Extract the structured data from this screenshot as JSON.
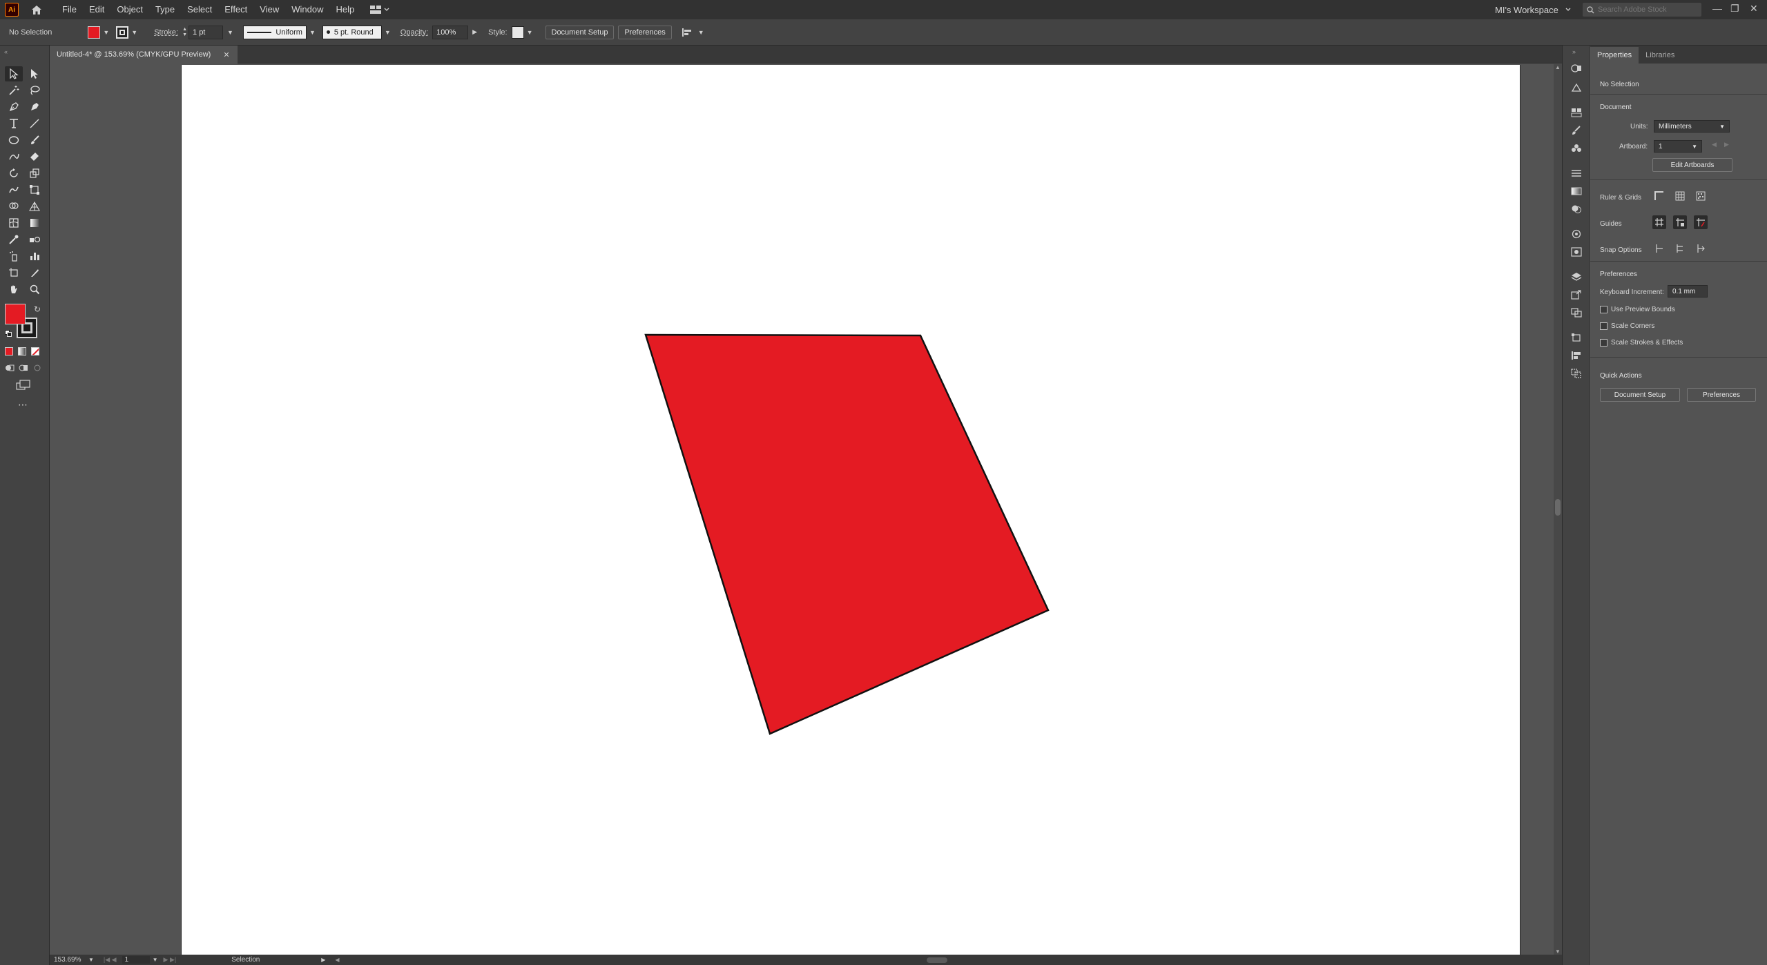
{
  "menubar": {
    "app_logo": "Ai",
    "items": [
      "File",
      "Edit",
      "Object",
      "Type",
      "Select",
      "Effect",
      "View",
      "Window",
      "Help"
    ],
    "workspace": "MI's Workspace",
    "search_placeholder": "Search Adobe Stock"
  },
  "control_bar": {
    "selection_status": "No Selection",
    "fill_color": "#e41b23",
    "stroke_label": "Stroke:",
    "stroke_weight": "1 pt",
    "stroke_profile": "Uniform",
    "brush": "5 pt. Round",
    "opacity_label": "Opacity:",
    "opacity": "100%",
    "style_label": "Style:",
    "document_setup": "Document Setup",
    "preferences": "Preferences"
  },
  "document_tab": {
    "title": "Untitled-4* @ 153.69% (CMYK/GPU Preview)"
  },
  "canvas": {
    "shape_fill": "#e41b23",
    "shape_stroke": "#111111"
  },
  "status_bar": {
    "zoom": "153.69%",
    "artboard_number": "1",
    "tool_status": "Selection"
  },
  "properties": {
    "tabs": [
      "Properties",
      "Libraries"
    ],
    "selection": "No Selection",
    "document_heading": "Document",
    "units_label": "Units:",
    "units_value": "Millimeters",
    "artboard_label": "Artboard:",
    "artboard_value": "1",
    "edit_artboards": "Edit Artboards",
    "ruler_grids": "Ruler & Grids",
    "guides": "Guides",
    "snap_options": "Snap Options",
    "preferences_heading": "Preferences",
    "keyboard_increment_label": "Keyboard Increment:",
    "keyboard_increment_value": "0.1 mm",
    "use_preview_bounds": "Use Preview Bounds",
    "scale_corners": "Scale Corners",
    "scale_strokes": "Scale Strokes & Effects",
    "quick_actions": "Quick Actions",
    "qa_document_setup": "Document Setup",
    "qa_preferences": "Preferences"
  }
}
